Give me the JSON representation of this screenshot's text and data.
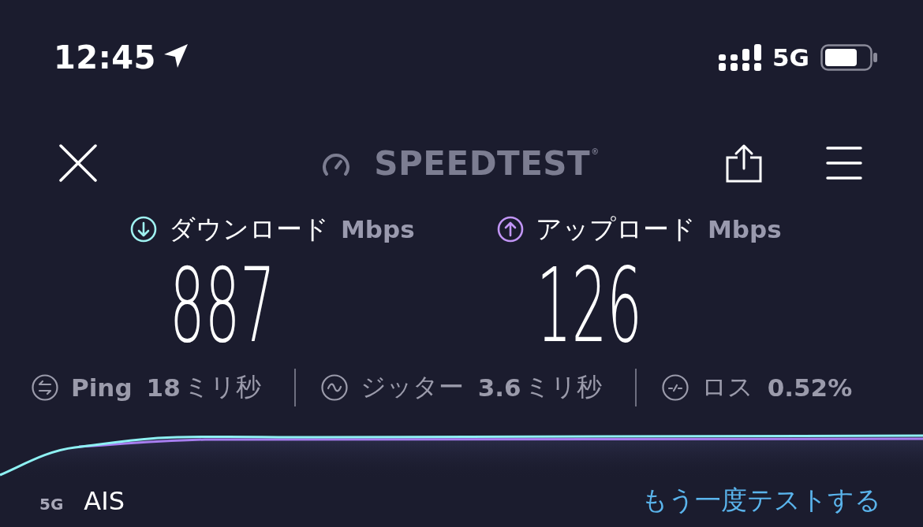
{
  "status_bar": {
    "time": "12:45",
    "network": "5G"
  },
  "header": {
    "logo": "SPEEDTEST$^{®}$"
  },
  "results": [
    {
      "kind": "download",
      "label": "ダウンロード",
      "unit": "Mbps",
      "value": "887",
      "color": "#9ff1f0"
    },
    {
      "kind": "upload",
      "label": "アップロード",
      "unit": "Mbps",
      "value": "126",
      "color": "#c195f5"
    }
  ],
  "stats": [
    {
      "kind": "ping",
      "label": "Ping",
      "value": "18",
      "unit": "ミリ秒"
    },
    {
      "kind": "jitter",
      "label": "ジッター",
      "value": "3.6",
      "unit": "ミリ秒"
    },
    {
      "kind": "loss",
      "label": "ロス",
      "value": "0.52%"
    }
  ],
  "footer": {
    "connection": "5G",
    "carrier": "AIS",
    "retest": "もう一度テストする"
  }
}
